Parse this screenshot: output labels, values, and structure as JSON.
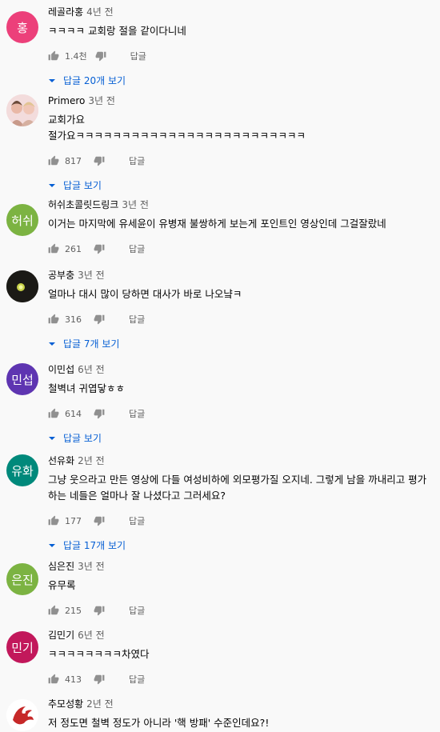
{
  "actions": {
    "reply_label": "답글"
  },
  "comments": [
    {
      "author": "레골라홍",
      "time": "4년 전",
      "text": "ㅋㅋㅋㅋ 교회랑 절을 같이다니네",
      "likes": "1.4천",
      "replies_label": "답글 20개 보기",
      "avatar": {
        "kind": "initials",
        "initials": "홍",
        "color": "#ec407a"
      }
    },
    {
      "author": "Primero",
      "time": "3년 전",
      "text": "교회가요\n절가요ㅋㅋㅋㅋㅋㅋㅋㅋㅋㅋㅋㅋㅋㅋㅋㅋㅋㅋㅋㅋㅋㅋㅋㅋㅋ",
      "likes": "817",
      "replies_label": "답글 보기",
      "avatar": {
        "kind": "photo",
        "color": "#f3d6d6"
      }
    },
    {
      "author": "허쉬초콜릿드링크",
      "time": "3년 전",
      "text": "이거는 마지막에 유세윤이 유병재 불쌍하게 보는게 포인트인 영상인데 그걸잘랐네",
      "likes": "261",
      "replies_label": "",
      "avatar": {
        "kind": "initials",
        "initials": "허쉬",
        "color": "#7cb342"
      }
    },
    {
      "author": "공부충",
      "time": "3년 전",
      "text": "얼마나 대시 많이 당하면 대사가 바로 나오냨ㅋ",
      "likes": "316",
      "replies_label": "답글 7개 보기",
      "avatar": {
        "kind": "dark-dot",
        "color": "#1b1a16"
      }
    },
    {
      "author": "이민섭",
      "time": "6년 전",
      "text": "철벽녀 귀엽닿ㅎㅎ",
      "likes": "614",
      "replies_label": "답글 보기",
      "avatar": {
        "kind": "initials",
        "initials": "민섭",
        "color": "#5e35b1"
      }
    },
    {
      "author": "선유화",
      "time": "2년 전",
      "text": "그냥 웃으라고 만든 영상에 다들 여성비하에 외모평가질 오지네. 그렇게 남을 까내리고 평가하는 네들은 얼마나 잘 나셨다고 그러세요?",
      "likes": "177",
      "replies_label": "답글 17개 보기",
      "avatar": {
        "kind": "initials",
        "initials": "유화",
        "color": "#00897b"
      }
    },
    {
      "author": "심은진",
      "time": "3년 전",
      "text": "유무록",
      "likes": "215",
      "replies_label": "",
      "avatar": {
        "kind": "initials",
        "initials": "은진",
        "color": "#7cb342"
      }
    },
    {
      "author": "김민기",
      "time": "6년 전",
      "text": "ㅋㅋㅋㅋㅋㅋㅋㅋ차였다",
      "likes": "413",
      "replies_label": "",
      "avatar": {
        "kind": "initials",
        "initials": "민기",
        "color": "#c2185b"
      }
    },
    {
      "author": "추모성황",
      "time": "2년 전",
      "text": "저 정도면 철벽 정도가 아니라 '핵 방패' 수준인데요?!",
      "likes": "",
      "replies_label": "",
      "avatar": {
        "kind": "emblem",
        "color": "#ffffff"
      }
    }
  ]
}
